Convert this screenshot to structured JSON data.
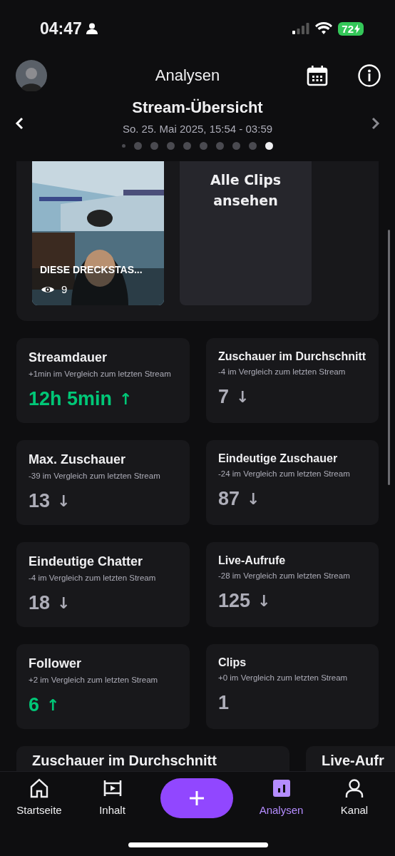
{
  "status_bar": {
    "time": "04:47",
    "battery": "72"
  },
  "header": {
    "title": "Analysen"
  },
  "overview": {
    "title": "Stream-Übersicht",
    "date": "So. 25. Mai 2025, 15:54 - 03:59",
    "pages": [
      {
        "selected": false
      },
      {
        "selected": false
      },
      {
        "selected": false
      },
      {
        "selected": false
      },
      {
        "selected": false
      },
      {
        "selected": false
      },
      {
        "selected": false
      },
      {
        "selected": false
      },
      {
        "selected": false
      },
      {
        "selected": true
      }
    ]
  },
  "clips": {
    "clip": {
      "kind": "picture",
      "title": "DIESE DRECKSTAS...",
      "views": "9"
    },
    "all_clips": "Alle Clips ansehen"
  },
  "stats": [
    {
      "title": "Streamdauer",
      "comparison": "+1min im Vergleich zum letzten Stream",
      "value": "12h 5min",
      "arrow": "↑",
      "increased": true
    },
    {
      "title": "Zuschauer im Durchschnitt",
      "comparison": "-4 im Vergleich zum letzten Stream",
      "value": "7",
      "arrow": "↓",
      "increased": false
    },
    {
      "title": "Max. Zuschauer",
      "comparison": "-39 im Vergleich zum letzten Stream",
      "value": "13",
      "arrow": "↓",
      "increased": false
    },
    {
      "title": "Eindeutige Zuschauer",
      "comparison": "-24 im Vergleich zum letzten Stream",
      "value": "87",
      "arrow": "↓",
      "increased": false
    },
    {
      "title": "Eindeutige Chatter",
      "comparison": "-4 im Vergleich zum letzten Stream",
      "value": "18",
      "arrow": "↓",
      "increased": false
    },
    {
      "title": "Live-Aufrufe",
      "comparison": "-28 im Vergleich zum letzten Stream",
      "value": "125",
      "arrow": "↓",
      "increased": false
    },
    {
      "title": "Follower",
      "comparison": "+2 im Vergleich zum letzten Stream",
      "value": "6",
      "arrow": "↑",
      "increased": true
    },
    {
      "title": "Clips",
      "comparison": "+0 im Vergleich zum letzten Stream",
      "value": "1",
      "increased": false
    }
  ],
  "charts_peek": [
    {
      "title": "Zuschauer im Durchschnitt"
    },
    {
      "title": "Live-Aufr"
    }
  ],
  "tab_bar": [
    {
      "kind": "home",
      "label": "Startseite",
      "selected": false
    },
    {
      "kind": "content",
      "label": "Inhalt",
      "selected": false
    },
    {
      "kind": "create"
    },
    {
      "kind": "analytics",
      "label": "Analysen",
      "selected": true
    },
    {
      "kind": "channel",
      "label": "Kanal",
      "selected": false
    }
  ]
}
